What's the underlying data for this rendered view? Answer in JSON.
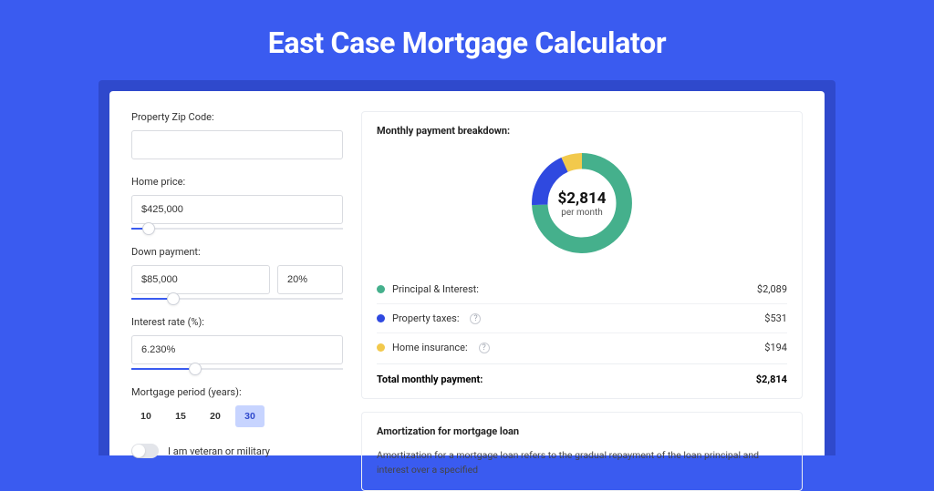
{
  "title": "East Case Mortgage Calculator",
  "form": {
    "zip_label": "Property Zip Code:",
    "zip_value": "",
    "home_price_label": "Home price:",
    "home_price_value": "$425,000",
    "home_price_pct": 8,
    "down_payment_label": "Down payment:",
    "down_payment_value": "$85,000",
    "down_payment_pct_value": "20%",
    "down_payment_slider_pct": 20,
    "interest_label": "Interest rate (%):",
    "interest_value": "6.230%",
    "interest_slider_pct": 30,
    "period_label": "Mortgage period (years):",
    "periods": [
      "10",
      "15",
      "20",
      "30"
    ],
    "period_selected": "30",
    "veteran_label": "I am veteran or military"
  },
  "breakdown": {
    "title": "Monthly payment breakdown:",
    "center_amount": "$2,814",
    "center_sub": "per month",
    "items": [
      {
        "label": "Principal & Interest:",
        "amount": "$2,089",
        "color": "#45b08c",
        "info": false
      },
      {
        "label": "Property taxes:",
        "amount": "$531",
        "color": "#2f49e0",
        "info": true
      },
      {
        "label": "Home insurance:",
        "amount": "$194",
        "color": "#f2c94c",
        "info": true
      }
    ],
    "total_label": "Total monthly payment:",
    "total_amount": "$2,814"
  },
  "chart_data": {
    "type": "pie",
    "title": "Monthly payment breakdown",
    "series": [
      {
        "name": "Principal & Interest",
        "value": 2089,
        "color": "#45b08c"
      },
      {
        "name": "Property taxes",
        "value": 531,
        "color": "#2f49e0"
      },
      {
        "name": "Home insurance",
        "value": 194,
        "color": "#f2c94c"
      }
    ],
    "total": 2814,
    "unit": "USD per month"
  },
  "amortization": {
    "title": "Amortization for mortgage loan",
    "text": "Amortization for a mortgage loan refers to the gradual repayment of the loan principal and interest over a specified"
  }
}
